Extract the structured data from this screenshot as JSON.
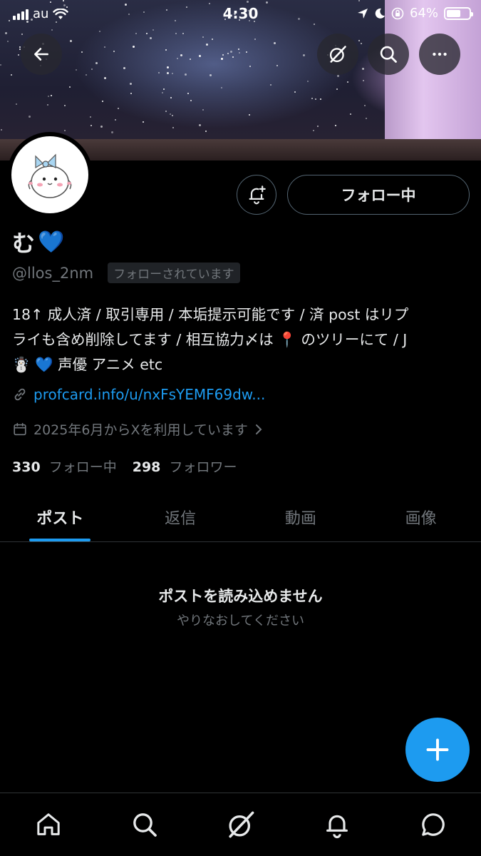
{
  "status_bar": {
    "carrier": "au",
    "time": "4:30",
    "battery_percent": "64%",
    "battery_level": 0.64
  },
  "header": {
    "back_icon": "arrow-left-icon",
    "grok_icon": "grok-icon",
    "search_icon": "search-icon",
    "more_icon": "more-icon"
  },
  "profile": {
    "name": "む",
    "name_emoji": "💙",
    "handle": "@llos_2nm",
    "follows_you": "フォローされています",
    "follow_button": "フォロー中",
    "bio_lines": [
      "18↑ 成人済 / 取引専用 / 本垢提示可能です / 済 post はリプ",
      "ライも含め削除してます / 相互協力〆は 📍 のツリーにて / J",
      "☃️ 💙 声優 アニメ etc"
    ],
    "link": "profcard.info/u/nxFsYEMF69dw...",
    "joined": "2025年6月からXを利用しています",
    "following_count": "330",
    "following_label": "フォロー中",
    "followers_count": "298",
    "followers_label": "フォロワー"
  },
  "tabs": [
    {
      "label": "ポスト",
      "active": true
    },
    {
      "label": "返信",
      "active": false
    },
    {
      "label": "動画",
      "active": false
    },
    {
      "label": "画像",
      "active": false
    }
  ],
  "empty_state": {
    "title": "ポストを読み込めません",
    "subtitle": "やりなおしてください"
  },
  "bottom_nav": [
    "home-icon",
    "search-icon",
    "grok-icon",
    "bell-icon",
    "chat-icon"
  ],
  "colors": {
    "accent": "#1d9bf0",
    "background": "#000000",
    "muted": "#71767b",
    "border": "#2f3336"
  }
}
